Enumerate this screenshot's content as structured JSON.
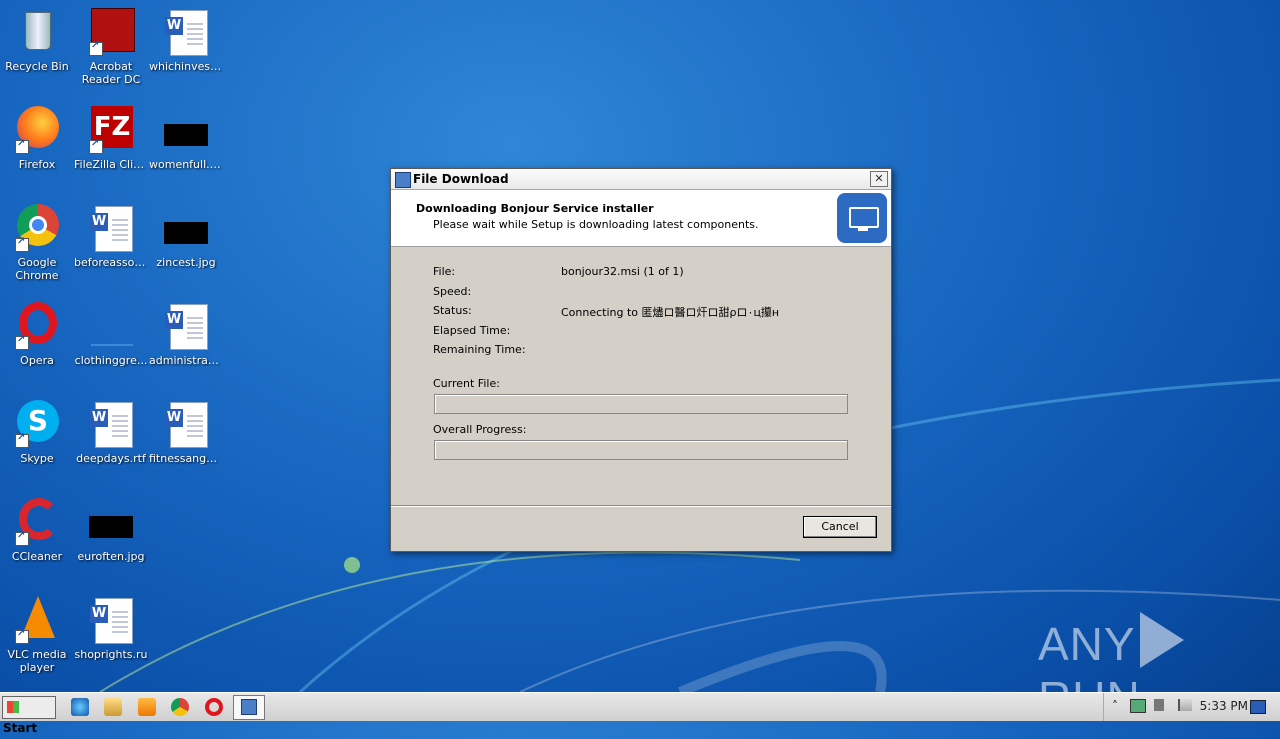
{
  "desktop": {
    "icons": [
      {
        "label": "Recycle Bin"
      },
      {
        "label": "Acrobat Reader DC"
      },
      {
        "label": "whichinvest..."
      },
      {
        "label": "Firefox"
      },
      {
        "label": "FileZilla Client"
      },
      {
        "label": "womenfull.jpg"
      },
      {
        "label": "Google Chrome"
      },
      {
        "label": "beforeassoc..."
      },
      {
        "label": "zincest.jpg"
      },
      {
        "label": "Opera"
      },
      {
        "label": "clothinggre..."
      },
      {
        "label": "administrati..."
      },
      {
        "label": "Skype"
      },
      {
        "label": "deepdays.rtf"
      },
      {
        "label": "fitnessange..."
      },
      {
        "label": "CCleaner"
      },
      {
        "label": "euroften.jpg"
      },
      {
        "label": "VLC media player"
      },
      {
        "label": "shoprights.ru"
      }
    ]
  },
  "dialog": {
    "title": "File Download",
    "close_glyph": "✕",
    "heading": "Downloading Bonjour Service installer",
    "subheading": "Please wait while Setup is downloading latest components.",
    "fields": {
      "file_label": "File:",
      "file_value": "bonjour32.msi (1 of 1)",
      "speed_label": "Speed:",
      "speed_value": "",
      "status_label": "Status:",
      "status_value": "Connecting to 匿燼ロ醫ロ㶥ロ甜ρロ٠ц攥н",
      "elapsed_label": "Elapsed Time:",
      "remaining_label": "Remaining Time:",
      "current_file_label": "Current File:",
      "overall_label": "Overall Progress:"
    },
    "progress": {
      "current_file": 0,
      "overall": 0
    },
    "cancel_label": "Cancel"
  },
  "taskbar": {
    "start_label": "Start",
    "clock": "5:33 PM",
    "tray_up_glyph": "˄"
  },
  "watermark": {
    "left": "ANY",
    "right": "RUN"
  }
}
